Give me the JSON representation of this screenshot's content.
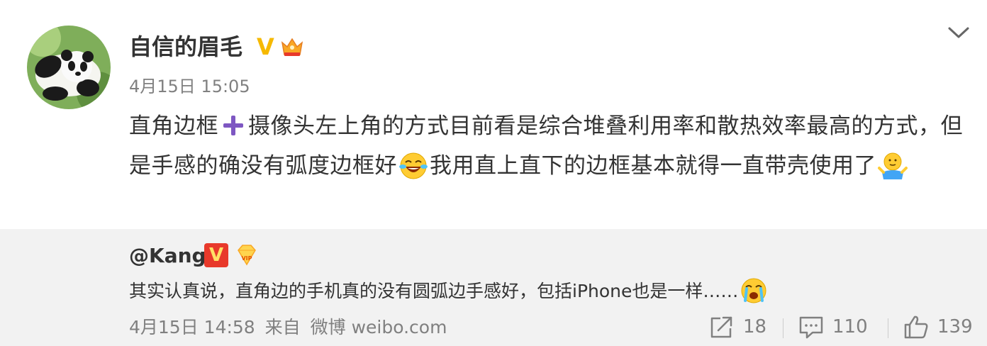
{
  "post": {
    "username": "自信的眉毛",
    "verified_badge": "V",
    "badge_icon": "crown-icon",
    "timestamp": "4月15日 15:05",
    "text_part1": "直角边框",
    "text_part2": "摄像头左上角的方式目前看是综合堆叠利用率和散热效率最高的方式，但是手感的确没有弧度边框好",
    "text_part3": "我用直上直下的边框基本就得一直带壳使用了",
    "emoji_icons": [
      "plus-icon",
      "laughing-tears-emoji",
      "shrug-emoji"
    ]
  },
  "repost": {
    "username": "@Kang",
    "verified_badge": "V",
    "vip_icon": "vip-diamond-icon",
    "text": "其实认真说，直角边的手机真的没有圆弧边手感好，包括iPhone也是一样……",
    "emoji_icon": "crying-emoji",
    "timestamp": "4月15日 14:58",
    "source_prefix": "来自",
    "source": "微博 weibo.com"
  },
  "actions": {
    "share_count": "18",
    "comment_count": "110",
    "like_count": "139"
  },
  "colors": {
    "verified": "#f6b900",
    "red_badge": "#e8392b",
    "repost_bg": "#f2f2f2",
    "muted_text": "#808080"
  }
}
